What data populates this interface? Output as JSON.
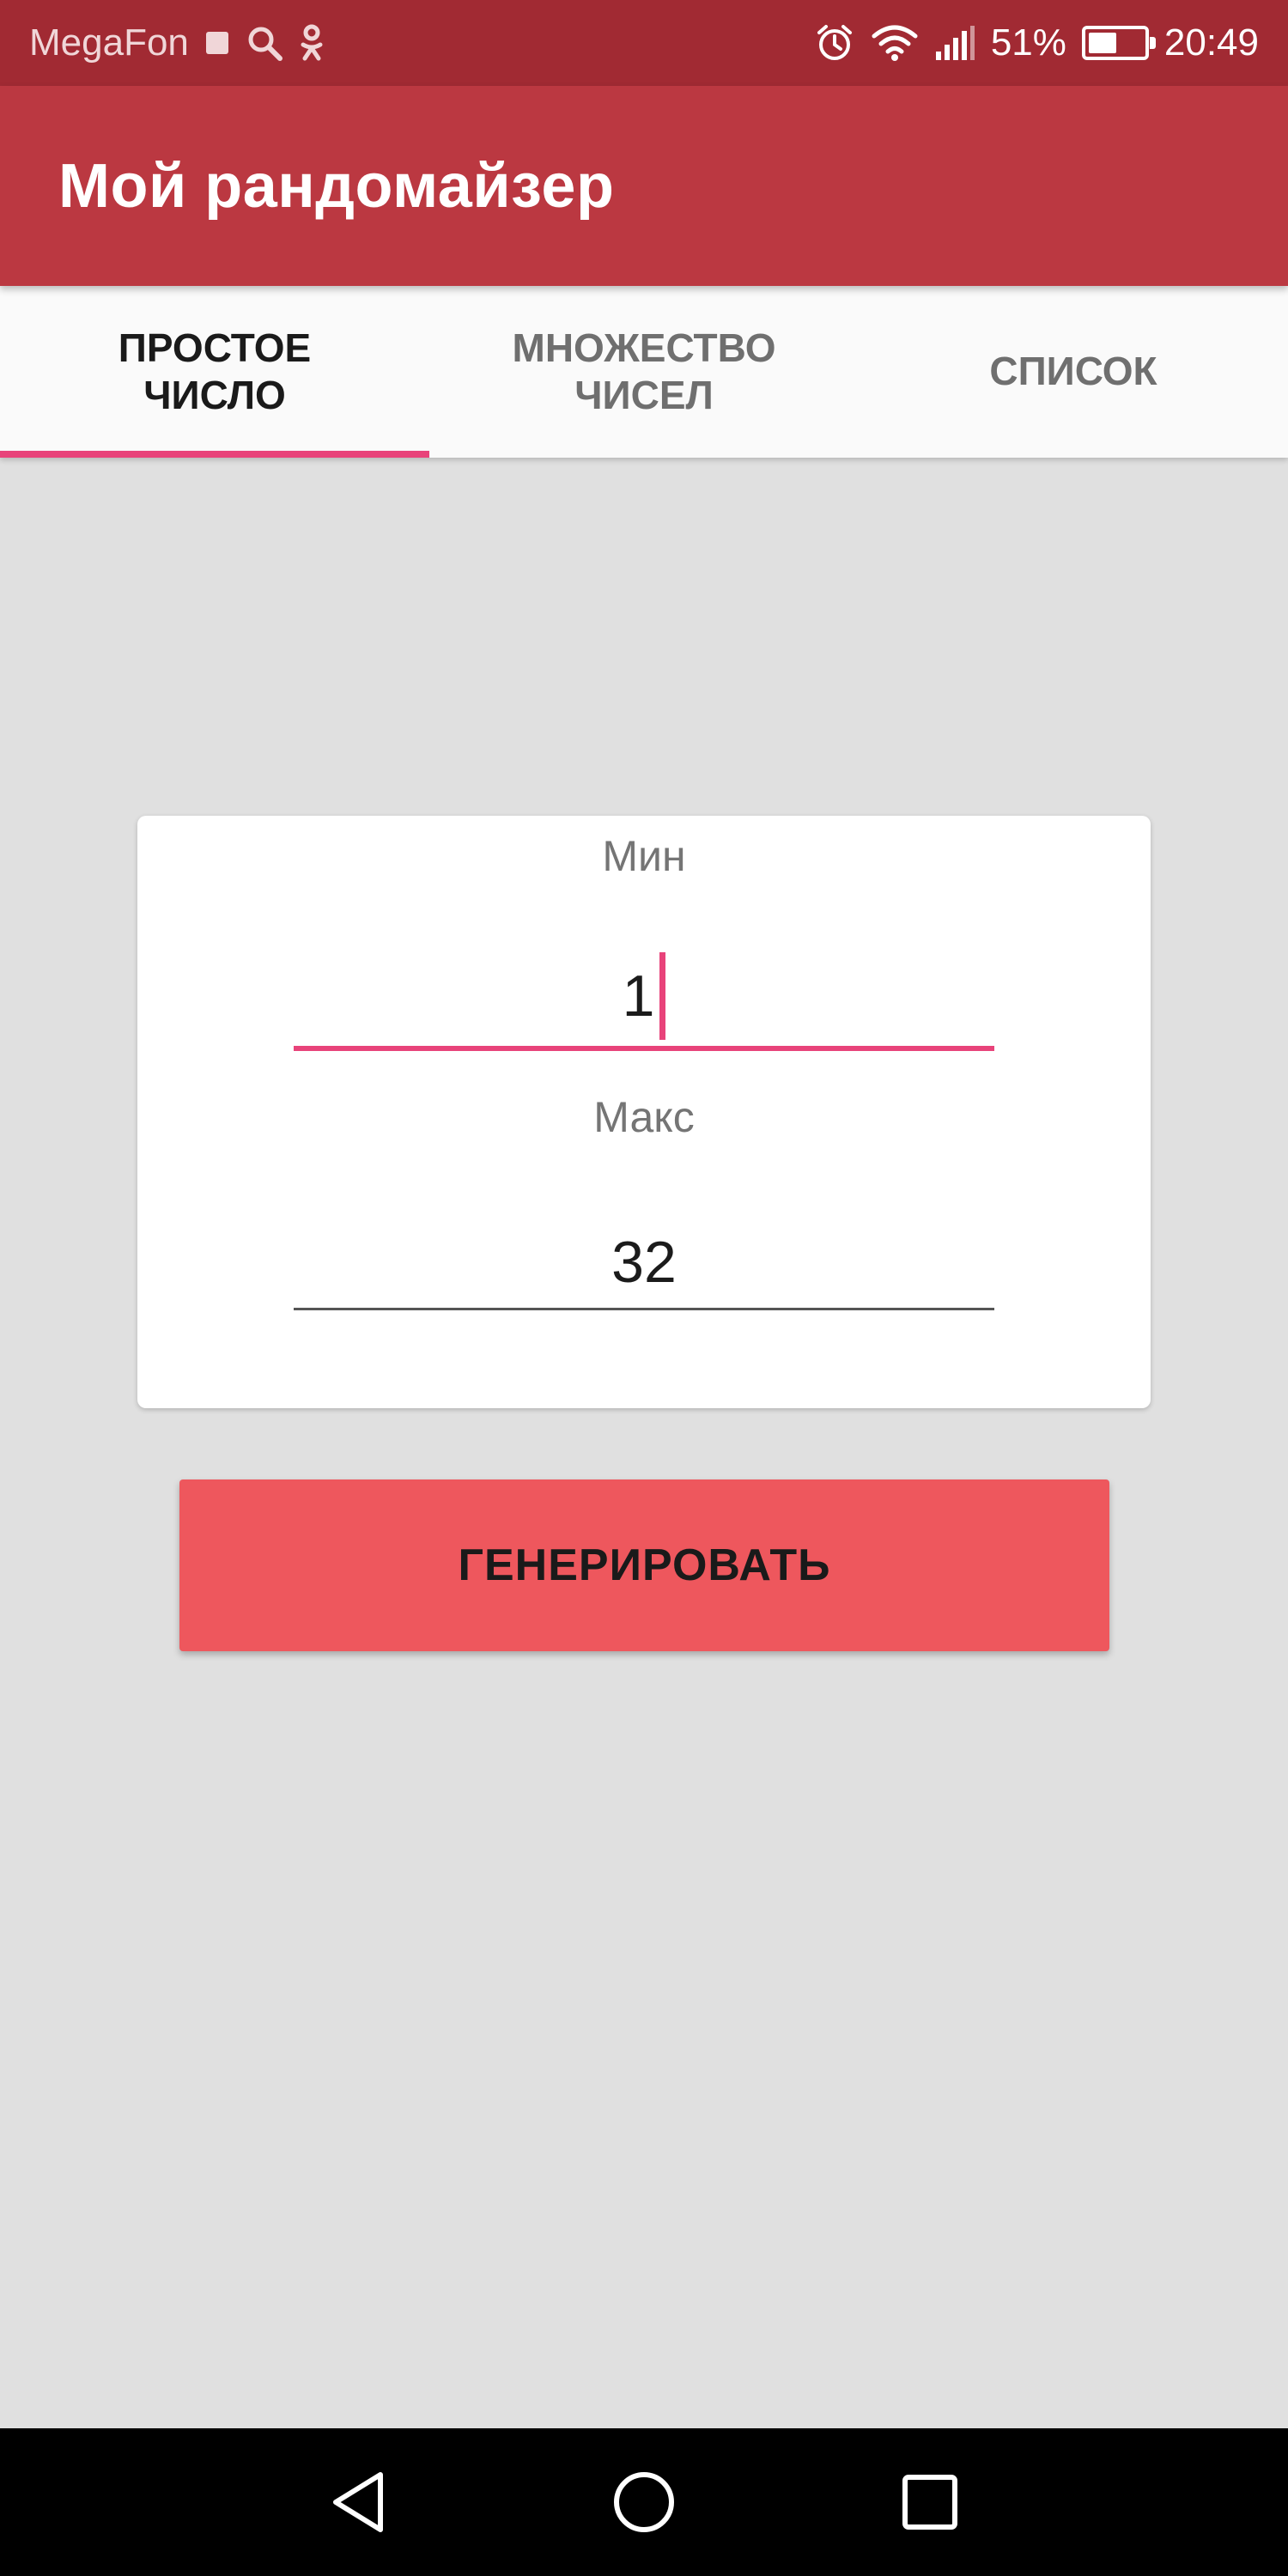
{
  "status_bar": {
    "carrier": "MegaFon",
    "battery_percent": "51%",
    "battery_level": 0.51,
    "time": "20:49",
    "icons": [
      "stop-square-icon",
      "search-icon",
      "odnoklassniki-icon",
      "alarm-icon",
      "wifi-icon",
      "signal-icon",
      "battery-icon"
    ]
  },
  "app_bar": {
    "title": "Мой рандомайзер",
    "color": "#bb3841"
  },
  "tabs": [
    {
      "label": "ПРОСТОЕ\nЧИСЛО",
      "active": true
    },
    {
      "label": "МНОЖЕСТВО\nЧИСЕЛ",
      "active": false
    },
    {
      "label": "СПИСОК",
      "active": false
    }
  ],
  "form": {
    "min_label": "Мин",
    "min_value": "1",
    "max_label": "Макс",
    "max_value": "32"
  },
  "generate_button": {
    "label": "ГЕНЕРИРОВАТЬ",
    "color": "#ee575d"
  },
  "accent_color": "#e8437a",
  "nav_bar": {
    "icons": [
      "back-icon",
      "home-icon",
      "recents-icon"
    ]
  }
}
